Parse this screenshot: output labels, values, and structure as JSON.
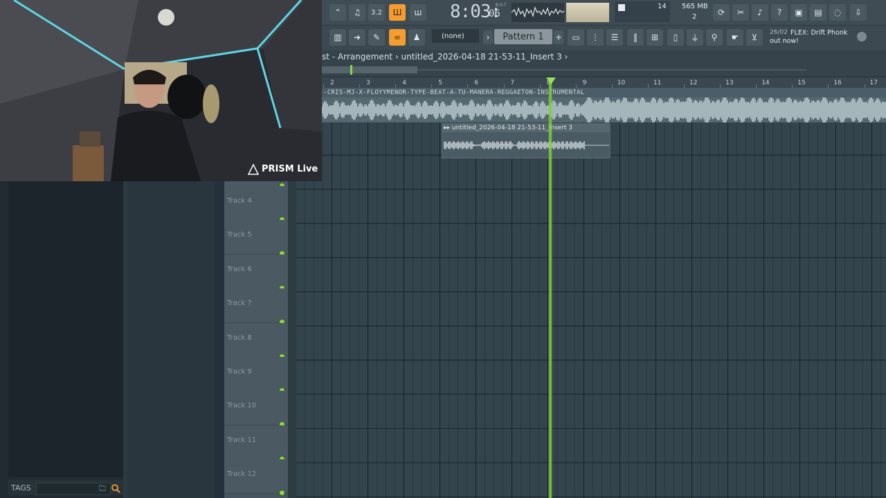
{
  "browser": {
    "tags_label": "TAGS"
  },
  "tracks": [
    {
      "label": "Track 4"
    },
    {
      "label": "Track 5"
    },
    {
      "label": "Track 6"
    },
    {
      "label": "Track 7"
    },
    {
      "label": "Track 8"
    },
    {
      "label": "Track 9"
    },
    {
      "label": "Track 10"
    },
    {
      "label": "Track 11"
    },
    {
      "label": "Track 12"
    }
  ],
  "toolbar": {
    "time_main": "8:03:",
    "time_small": "06",
    "time_tz": "B:S:T",
    "cpu_value": "14",
    "memory": "565 MB",
    "polyphony": "2",
    "tempo_badge": "3.2",
    "pattern_none": "(none)",
    "pattern_selected": "Pattern 1",
    "news_date": "26/02",
    "news_line1": "FLEX: Drift Phonk",
    "news_line2": "out now!"
  },
  "breadcrumb": {
    "text": "st - Arrangement › untitled_2026-04-18 21-53-11_Insert 3 ›"
  },
  "ruler": {
    "bars": [
      "2",
      "3",
      "4",
      "5",
      "6",
      "7",
      "8",
      "9",
      "10",
      "11",
      "12",
      "13",
      "14",
      "15",
      "16",
      "17"
    ]
  },
  "playlist": {
    "audio_clip_title": "-CRIS-MJ-X-FLOYYMENOR-TYPE-BEAT-A-TU-MANERA-REGGAETON-INSTRUMENTAL",
    "insert_clip_title": "▸▸ untitled_2026-04-18 21-53-11_Insert 3",
    "playhead_bar": 8.3
  },
  "webcam": {
    "overlay_text": "PRISM Live"
  },
  "colors": {
    "accent": "#f39c2f",
    "playhead": "#7fd235",
    "grid_bg": "#34444d"
  }
}
